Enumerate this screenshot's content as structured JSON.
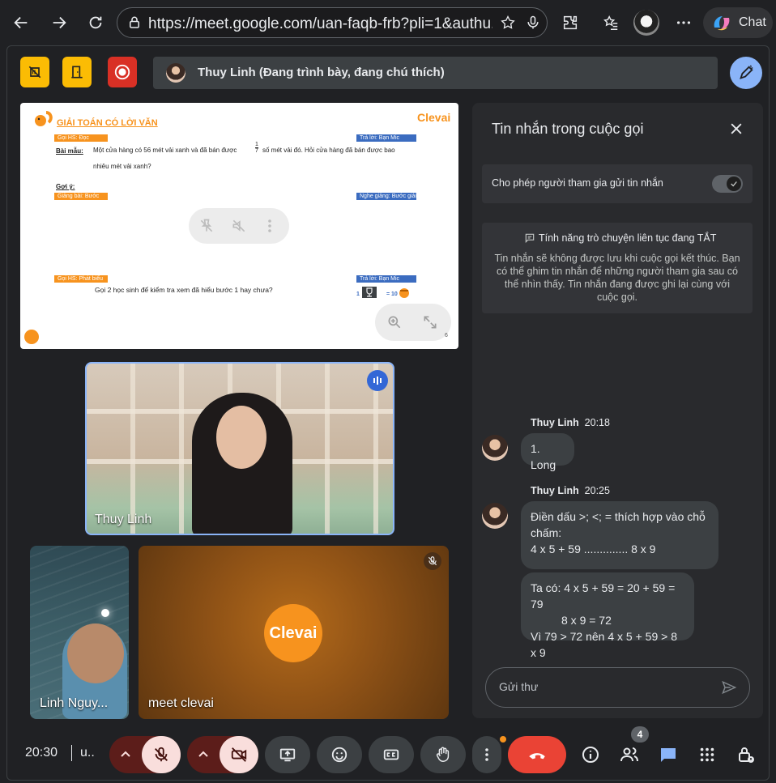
{
  "browser": {
    "url": "https://meet.google.com/uan-faqb-frb?pli=1&authu...",
    "chat_label": "Chat"
  },
  "meeting": {
    "presenter_label": "Thuy Linh (Đang trình bày, đang chú thích)",
    "time": "20:30",
    "meeting_code": "u..",
    "participant_count": "4"
  },
  "slide": {
    "title": "GIẢI TOÁN CÓ LỜI VĂN",
    "brand": "Clevai",
    "tag_goi_hs_doc": "Gọi HS: Đọc",
    "tag_tra_loi_1": "Trả lời: Bạn Mic",
    "sample_label": "Bài mẫu:",
    "problem_line1": "Một cửa hàng có 56 mét vải xanh và đã bán được",
    "fraction_num": "1",
    "fraction_den": "7",
    "problem_line1_end": "số mét vải đó. Hỏi cửa hàng đã bán được bao",
    "problem_line2": "nhiêu mét vải xanh?",
    "hint_label": "Gợi ý:",
    "tag_giang_bai": "Giảng bài: Bước giải",
    "tag_nghe_giang": "Nghe giảng: Bước giải",
    "tag_goi_hs_phat_bieu": "Gọi HS: Phát biểu",
    "tag_tra_loi_2": "Trả lời: Bạn Mic",
    "ask_line": "Gọi 2 học sinh để kiểm tra xem đã hiểu bước 1 hay chưa?",
    "reward_left": "1",
    "reward_right": "= 10",
    "page_number": "6"
  },
  "tiles": {
    "main_name": "Thuy Linh",
    "small_name": "Linh Nguy...",
    "clevai_name": "meet clevai",
    "clevai_logo": "Clevai"
  },
  "chat": {
    "title": "Tin nhắn trong cuộc gọi",
    "allow_label": "Cho phép người tham gia gửi tin nhắn",
    "continuous_title": "Tính năng trò chuyện liên tục đang TẮT",
    "continuous_body": "Tin nhắn sẽ không được lưu khi cuộc gọi kết thúc. Bạn có thể ghim tin nhắn để những người tham gia sau có thể nhìn thấy. Tin nhắn đang được ghi lại cùng với cuộc gọi.",
    "messages": [
      {
        "sender": "Thuy Linh",
        "time": "20:18",
        "lines": [
          "1. Long"
        ]
      },
      {
        "sender": "Thuy Linh",
        "time": "20:25",
        "bubble1": [
          "Điền dấu >; <; = thích hợp vào chỗ",
          "chấm:",
          "4 x 5 + 59 .............. 8 x 9"
        ],
        "bubble2": [
          "Ta có: 4 x 5 + 59 = 20 + 59 = 79",
          "8 x 9 = 72",
          "Vì 79 > 72 nên 4 x 5 + 59 > 8 x 9"
        ]
      }
    ],
    "input_placeholder": "Gửi thư"
  },
  "colors": {
    "accent_yellow": "#fbbc04",
    "record_red": "#d93025",
    "end_call_red": "#ea4335",
    "clevai_orange": "#f7931e",
    "chat_blue": "#8ab4f8"
  }
}
